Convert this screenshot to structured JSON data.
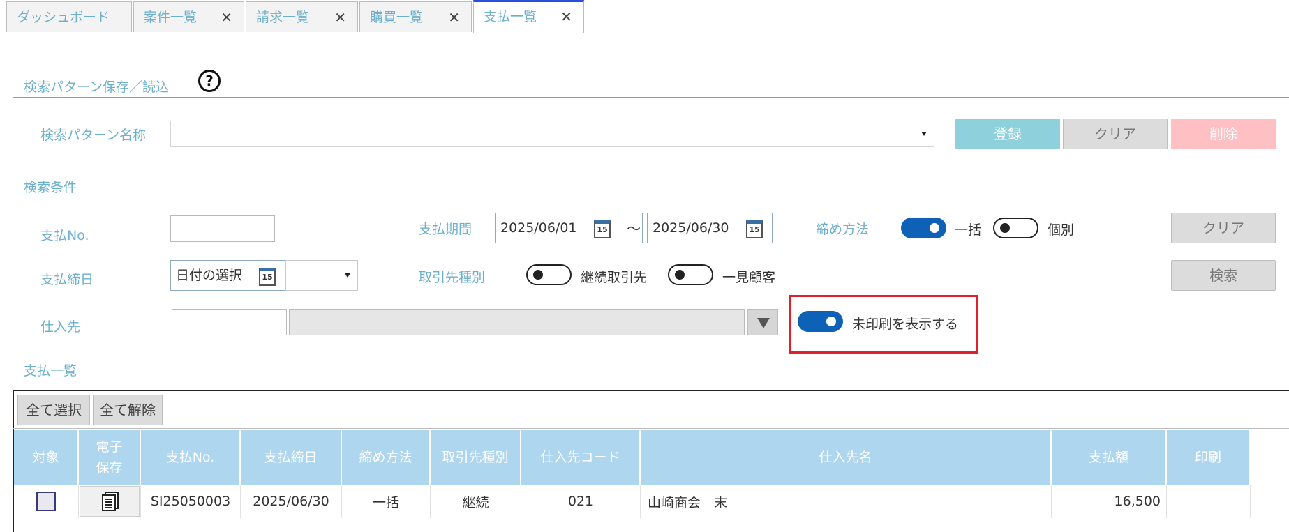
{
  "tabs": [
    {
      "label": "ダッシュボード",
      "closable": false
    },
    {
      "label": "案件一覧",
      "closable": true
    },
    {
      "label": "請求一覧",
      "closable": true
    },
    {
      "label": "購買一覧",
      "closable": true
    },
    {
      "label": "支払一覧",
      "closable": true,
      "active": true
    }
  ],
  "tab_close_glyph": "✕",
  "pattern": {
    "section_title": "検索パターン保存／読込",
    "help_glyph": "?",
    "name_label": "検索パターン名称",
    "name_value": "",
    "register_label": "登録",
    "clear_label": "クリア",
    "delete_label": "削除"
  },
  "conditions": {
    "section_title": "検索条件",
    "payment_no_label": "支払No.",
    "payment_no_value": "",
    "period_label": "支払期間",
    "period_from": "2025/06/01",
    "period_sep": "～",
    "period_to": "2025/06/30",
    "calendar_day": "15",
    "closing_method_label": "締め方法",
    "closing_method_options": [
      {
        "label": "一括",
        "on": true
      },
      {
        "label": "個別",
        "on": false
      }
    ],
    "clear_label": "クリア",
    "closing_date_label": "支払締日",
    "closing_date_placeholder": "日付の選択",
    "partner_type_label": "取引先種別",
    "partner_type_options": [
      {
        "label": "継続取引先",
        "on": false
      },
      {
        "label": "一見顧客",
        "on": false
      }
    ],
    "search_label": "検索",
    "supplier_label": "仕入先",
    "unprinted_label": "未印刷を表示する",
    "unprinted_on": true
  },
  "list": {
    "section_title": "支払一覧",
    "select_all_label": "全て選択",
    "deselect_all_label": "全て解除",
    "columns": [
      "対象",
      "電子\n保存",
      "支払No.",
      "支払締日",
      "締め方法",
      "取引先種別",
      "仕入先コード",
      "仕入先名",
      "支払額",
      "印刷"
    ],
    "rows": [
      {
        "payment_no": "SI25050003",
        "closing_date": "2025/06/30",
        "closing_method": "一括",
        "partner_type": "継続",
        "supplier_code": "021",
        "supplier_name": "山崎商会　末",
        "amount": "16,500",
        "print": ""
      }
    ]
  },
  "colors": {
    "accent_label": "#6cb0cc",
    "toggle_on": "#0d62b8",
    "header_bg": "#aed6ee",
    "highlight_box": "#e0202a"
  }
}
